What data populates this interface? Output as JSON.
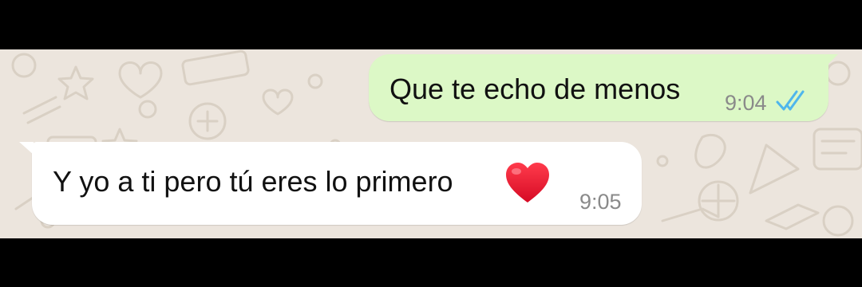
{
  "colors": {
    "wallpaper": "#ece5dd",
    "outgoing_bubble": "#dcf8c6",
    "incoming_bubble": "#ffffff",
    "read_ticks": "#4fb6ec",
    "heart": "#e8112d"
  },
  "messages": [
    {
      "direction": "outgoing",
      "text": "Que te echo de menos",
      "time": "9:04",
      "status_icon": "double-check-read-icon"
    },
    {
      "direction": "incoming",
      "text": "Y yo a ti pero tú eres lo primero",
      "emoji_icon": "red-heart-icon",
      "time": "9:05"
    }
  ]
}
